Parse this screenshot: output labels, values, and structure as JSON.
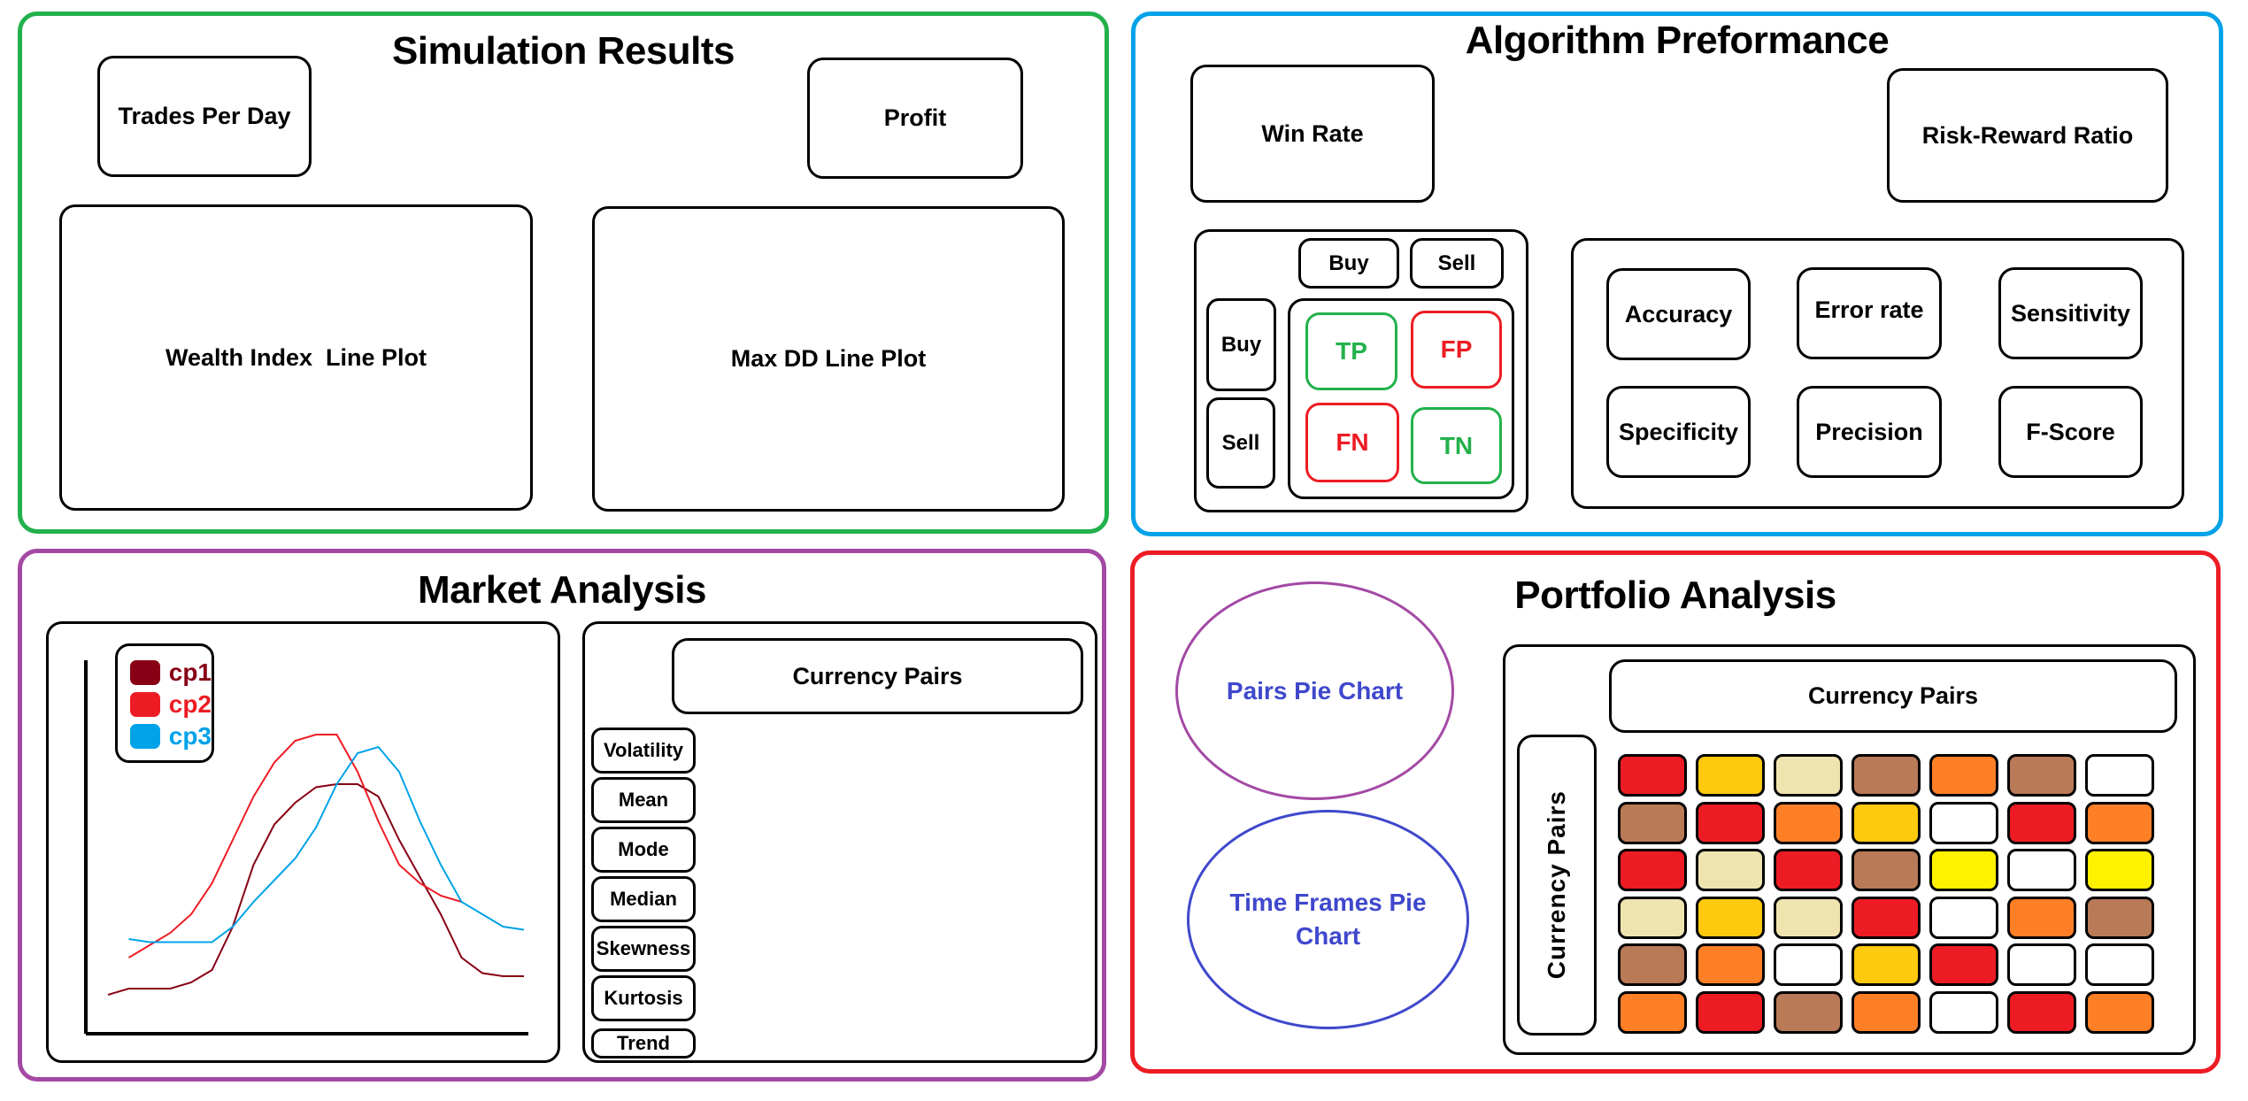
{
  "colors": {
    "simulation_border": "#22B14C",
    "algorithm_border": "#00A2E8",
    "market_border": "#A349A4",
    "portfolio_border": "#ED1C24",
    "positive": "#22B14C",
    "negative": "#ED1C24",
    "pie_pairs_border": "#A349A4",
    "pie_timeframes_border": "#3F48CC",
    "pie_label": "#3F48CC"
  },
  "simulation": {
    "title": "Simulation Results",
    "trades_per_day": "Trades Per Day",
    "profit": "Profit",
    "wealth_plot": "Wealth Index  Line Plot",
    "max_dd_plot": "Max DD Line Plot"
  },
  "algorithm": {
    "title": "Algorithm Preformance",
    "win_rate": "Win Rate",
    "risk_reward": "Risk-Reward Ratio",
    "confusion": {
      "col_headers": [
        "Buy",
        "Sell"
      ],
      "row_headers": [
        "Buy",
        "Sell"
      ],
      "cells": [
        {
          "label": "TP",
          "kind": "positive"
        },
        {
          "label": "FP",
          "kind": "negative"
        },
        {
          "label": "FN",
          "kind": "negative"
        },
        {
          "label": "TN",
          "kind": "positive"
        }
      ]
    },
    "metrics": [
      "Accuracy",
      "Error rate",
      "Sensitivity",
      "Specificity",
      "Precision",
      "F-Score"
    ]
  },
  "market": {
    "title": "Market Analysis",
    "stats_header": "Currency Pairs",
    "stats": [
      "Volatility",
      "Mean",
      "Mode",
      "Median",
      "Skewness",
      "Kurtosis",
      "Trend"
    ]
  },
  "portfolio": {
    "title": "Portfolio Analysis",
    "pairs_pie": "Pairs Pie Chart",
    "timeframes_pie": "Time Frames Pie Chart",
    "heatmap_col_header": "Currency Pairs",
    "heatmap_row_header": "Currency Pairs"
  },
  "chart_data": [
    {
      "type": "line",
      "title": "",
      "xlabel": "",
      "ylabel": "",
      "legend_position": "top-left",
      "grid": false,
      "x": [
        0,
        1,
        2,
        3,
        4,
        5,
        6,
        7,
        8,
        9,
        10,
        11,
        12,
        13,
        14,
        15,
        16,
        17,
        18,
        19,
        20
      ],
      "series": [
        {
          "name": "cp1",
          "color": "#880015",
          "values": [
            8,
            10,
            10,
            10,
            12,
            16,
            30,
            50,
            63,
            70,
            75,
            76,
            76,
            72,
            58,
            46,
            34,
            20,
            15,
            14,
            14
          ]
        },
        {
          "name": "cp2",
          "color": "#ED1C24",
          "values": [
            null,
            20,
            24,
            28,
            34,
            44,
            58,
            72,
            83,
            90,
            92,
            92,
            80,
            64,
            50,
            44,
            40,
            38,
            null,
            null,
            null
          ]
        },
        {
          "name": "cp3",
          "color": "#00A2E8",
          "values": [
            null,
            26,
            25,
            25,
            25,
            25,
            30,
            38,
            45,
            52,
            62,
            76,
            86,
            88,
            80,
            64,
            50,
            38,
            34,
            30,
            29
          ]
        }
      ],
      "ylim": [
        0,
        100
      ]
    },
    {
      "type": "heatmap",
      "title": "",
      "xlabel": "Currency Pairs",
      "ylabel": "Currency Pairs",
      "palette": {
        "red": "#ED1C24",
        "gold": "#FFC90E",
        "beige": "#EFE4B0",
        "brown": "#B97A57",
        "orange": "#FF7F27",
        "yellow": "#FFF200",
        "white": "#FFFFFF"
      },
      "rows": [
        [
          "red",
          "gold",
          "beige",
          "brown",
          "orange",
          "brown",
          "white"
        ],
        [
          "brown",
          "red",
          "orange",
          "gold",
          "white",
          "red",
          "orange"
        ],
        [
          "red",
          "beige",
          "red",
          "brown",
          "yellow",
          "white",
          "yellow"
        ],
        [
          "beige",
          "gold",
          "beige",
          "red",
          "white",
          "orange",
          "brown"
        ],
        [
          "brown",
          "orange",
          "white",
          "gold",
          "red",
          "white",
          "white"
        ],
        [
          "orange",
          "red",
          "brown",
          "orange",
          "white",
          "red",
          "orange"
        ]
      ]
    }
  ]
}
